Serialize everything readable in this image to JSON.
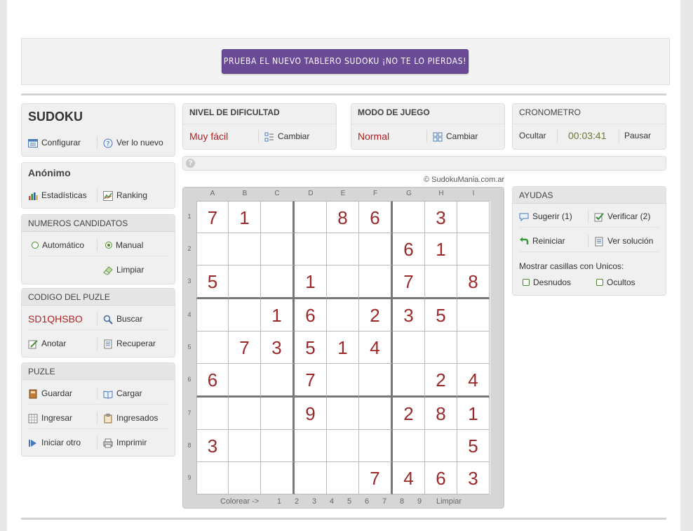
{
  "banner": {
    "label": "PRUEBA EL NUEVO TABLERO SUDOKU ¡NO TE LO PIERDAS!"
  },
  "sudoku_panel": {
    "title": "SUDOKU",
    "configure": "Configurar",
    "whats_new": "Ver lo nuevo"
  },
  "user_panel": {
    "title": "Anónimo",
    "stats": "Estadísticas",
    "ranking": "Ranking"
  },
  "candidates_panel": {
    "title": "NUMEROS CANDIDATOS",
    "automatic": "Automático",
    "manual": "Manual",
    "clear": "Limpiar",
    "selected": "Manual"
  },
  "code_panel": {
    "title": "CODIGO DEL PUZLE",
    "code": "SD1QHSBO",
    "search": "Buscar",
    "note": "Anotar",
    "recover": "Recuperar"
  },
  "puzzle_panel": {
    "title": "PUZLE",
    "save": "Guardar",
    "load": "Cargar",
    "enter": "Ingresar",
    "entered": "Ingresados",
    "restart": "Iniciar otro",
    "print": "Imprimir"
  },
  "difficulty_panel": {
    "title": "NIVEL DE DIFICULTAD",
    "value": "Muy fácil",
    "change": "Cambiar"
  },
  "mode_panel": {
    "title": "MODO DE JUEGO",
    "value": "Normal",
    "change": "Cambiar"
  },
  "timer_panel": {
    "title": "CRONOMETRO",
    "hide": "Ocultar",
    "time": "00:03:41",
    "pause": "Pausar"
  },
  "help_bar": {
    "icon": "question-icon"
  },
  "copyright": "© SudokuMania.com.ar",
  "board": {
    "columns": [
      "A",
      "B",
      "C",
      "D",
      "E",
      "F",
      "G",
      "H",
      "I"
    ],
    "rows": [
      "1",
      "2",
      "3",
      "4",
      "5",
      "6",
      "7",
      "8",
      "9"
    ],
    "cells": [
      [
        "7",
        "1",
        "",
        "",
        "8",
        "6",
        "",
        "3",
        ""
      ],
      [
        "",
        "",
        "",
        "",
        "",
        "",
        "6",
        "1",
        ""
      ],
      [
        "5",
        "",
        "",
        "1",
        "",
        "",
        "7",
        "",
        "8"
      ],
      [
        "",
        "",
        "1",
        "6",
        "",
        "2",
        "3",
        "5",
        ""
      ],
      [
        "",
        "7",
        "3",
        "5",
        "1",
        "4",
        "",
        "",
        ""
      ],
      [
        "6",
        "",
        "",
        "7",
        "",
        "",
        "",
        "2",
        "4"
      ],
      [
        "",
        "",
        "",
        "9",
        "",
        "",
        "2",
        "8",
        "1"
      ],
      [
        "3",
        "",
        "",
        "",
        "",
        "",
        "",
        "",
        "5"
      ],
      [
        "",
        "",
        "",
        "",
        "",
        "7",
        "4",
        "6",
        "3"
      ]
    ],
    "color_label": "Colorear ->",
    "color_numbers": [
      "1",
      "2",
      "3",
      "4",
      "5",
      "6",
      "7",
      "8",
      "9"
    ],
    "color_clear": "Limpiar"
  },
  "aids_panel": {
    "title": "AYUDAS",
    "suggest": "Sugerir (1)",
    "verify": "Verificar (2)",
    "reset": "Reiniciar",
    "solution": "Ver solución",
    "show_label": "Mostrar casillas con Unicos:",
    "naked": "Desnudos",
    "hidden": "Ocultos"
  }
}
